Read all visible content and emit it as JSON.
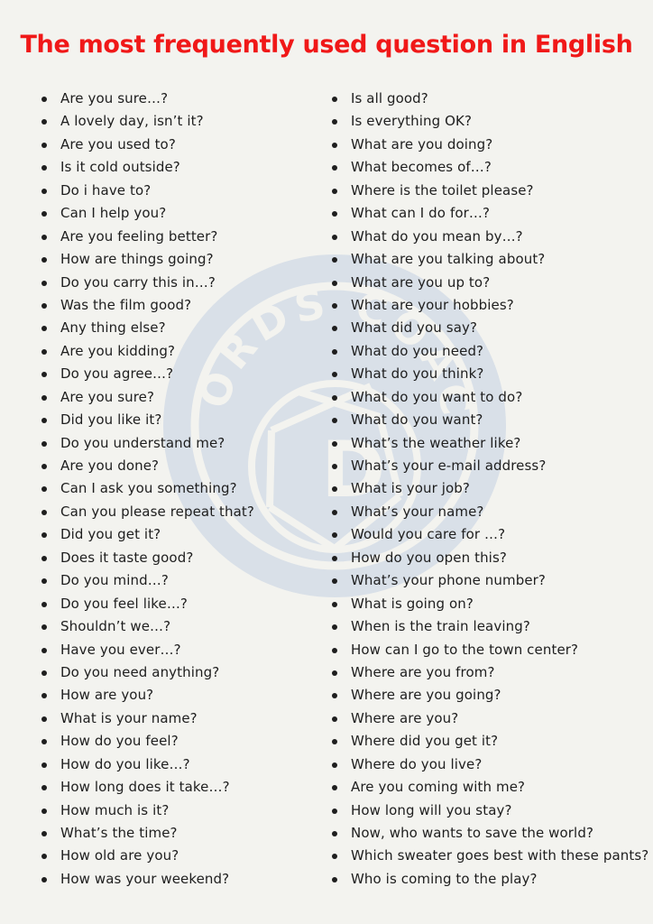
{
  "title": "The most frequently used question in English",
  "colors": {
    "title": "#f01818",
    "background": "#f3f3ef",
    "text": "#1e1e1e",
    "watermark": "#d9e0e8"
  },
  "watermark": {
    "text_top": "WORDS COACH",
    "letter": "D",
    "icon": "camera-aperture-icon"
  },
  "left_column": [
    "Are you sure…?",
    "A lovely day, isn’t it?",
    "Are you used to?",
    "Is it cold outside?",
    "Do i have to?",
    "Can I help you?",
    "Are you feeling better?",
    "How are things going?",
    "Do you carry this in…?",
    "Was the film good?",
    "Any thing else?",
    "Are you kidding?",
    "Do you agree…?",
    "Are you sure?",
    "Did you like it?",
    "Do you understand me?",
    "Are you done?",
    "Can I ask you something?",
    "Can you please repeat that?",
    "Did you get it?",
    "Does it taste good?",
    "Do you mind…?",
    "Do you feel like…?",
    "Shouldn’t we…?",
    "Have you ever…?",
    "Do you need anything?",
    "How are you?",
    "What is your name?",
    "How do you feel?",
    "How do you like…?",
    "How long does it take…?",
    "How much is it?",
    "What’s the time?",
    "How old are you?",
    "How was your weekend?"
  ],
  "right_column": [
    "Is all good?",
    "Is everything OK?",
    "What are you doing?",
    "What becomes of…?",
    "Where is the toilet please?",
    "What can I do for…?",
    "What do you mean by…?",
    "What are you talking about?",
    "What are you up to?",
    "What are your hobbies?",
    "What did you say?",
    "What do you need?",
    "What do you think?",
    "What do you want to do?",
    "What do you want?",
    "What’s the weather like?",
    "What’s your e-mail address?",
    "What is your job?",
    "What’s your name?",
    "Would you care for …?",
    "How do you open this?",
    "What’s your phone number?",
    "What is going on?",
    "When is the train leaving?",
    "How can I go to the town center?",
    "Where are you from?",
    "Where are you going?",
    "Where are you?",
    "Where did you get it?",
    "Where do you live?",
    "Are you coming with me?",
    "How long will you stay?",
    "Now, who wants to save the world?",
    "Which sweater goes best with these pants?",
    "Who is coming to the play?"
  ]
}
